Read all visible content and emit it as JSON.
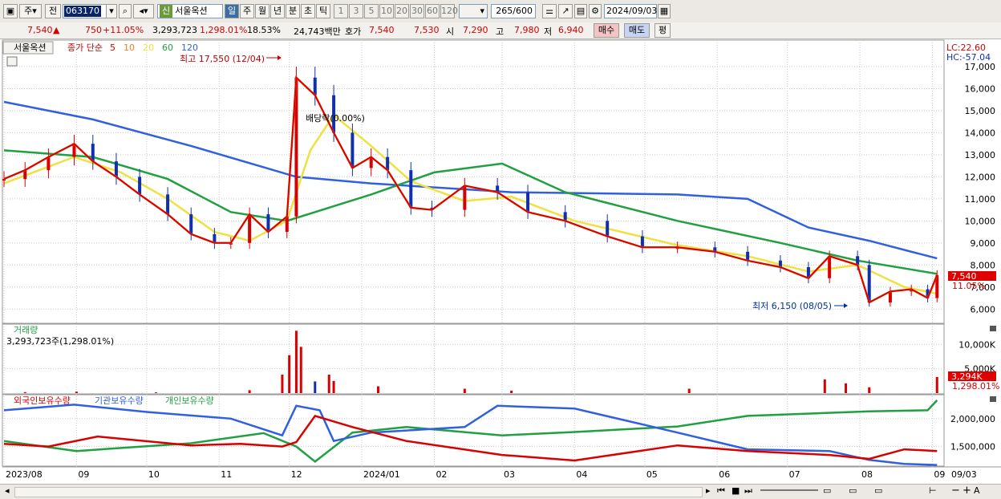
{
  "toolbar": {
    "market": "주",
    "prev_label": "전",
    "code": "063170",
    "stock_badge": "신",
    "stock_name": "서울옥션",
    "periods": [
      "일",
      "주",
      "월",
      "년",
      "분",
      "초",
      "틱"
    ],
    "intervals": [
      "1",
      "3",
      "5",
      "10",
      "20",
      "30",
      "60",
      "120"
    ],
    "count": "265",
    "count_total": "/600",
    "date": "2024/09/03"
  },
  "quote": {
    "price": "7,540",
    "change": "750",
    "change_pct": "+11.05%",
    "volume": "3,293,723",
    "volume_pct": "1,298.01%",
    "turnover_pct": "18.53%",
    "amount": "24,743백만",
    "ask_label": "호가",
    "ask": "7,540",
    "bid": "7,530",
    "open_label": "시",
    "open": "7,290",
    "high_label": "고",
    "high": "7,980",
    "low_label": "저",
    "low": "6,940",
    "buy": "매수",
    "sell": "매도",
    "eval": "평"
  },
  "chart_data": {
    "type": "line",
    "title": "서울옥션",
    "price_panel": {
      "legend_label": "종가 단순",
      "ma_periods": [
        5,
        10,
        20,
        60,
        120
      ],
      "ma_colors": [
        "#d80000",
        "#f08020",
        "#f0e040",
        "#20a040",
        "#3060e0"
      ],
      "ylim": [
        5500,
        17800
      ],
      "y_ticks": [
        6000,
        7000,
        8000,
        9000,
        10000,
        11000,
        12000,
        13000,
        14000,
        15000,
        16000,
        17000
      ],
      "y_tick_labels": [
        "6,000",
        "7,000",
        "8,000",
        "9,000",
        "10,000",
        "11,000",
        "12,000",
        "13,000",
        "14,000",
        "15,000",
        "16,000",
        "17,000"
      ],
      "lc": "LC:22.60",
      "hc": "HC:-57.04",
      "high_note": "최고 17,550 (12/04)",
      "low_note": "최저 6,150 (08/05)",
      "dividend_note": "배당락(0.00%)",
      "last_price": "7,540",
      "last_pct": "11.05%",
      "close_series": [
        {
          "d": "2023-08-01",
          "v": 11900
        },
        {
          "d": "2023-08-10",
          "v": 12300
        },
        {
          "d": "2023-08-20",
          "v": 12900
        },
        {
          "d": "2023-08-31",
          "v": 13500
        },
        {
          "d": "2023-09-08",
          "v": 12700
        },
        {
          "d": "2023-09-18",
          "v": 12000
        },
        {
          "d": "2023-09-28",
          "v": 11200
        },
        {
          "d": "2023-10-10",
          "v": 10300
        },
        {
          "d": "2023-10-20",
          "v": 9400
        },
        {
          "d": "2023-10-30",
          "v": 9000
        },
        {
          "d": "2023-11-06",
          "v": 9000
        },
        {
          "d": "2023-11-14",
          "v": 10300
        },
        {
          "d": "2023-11-22",
          "v": 9500
        },
        {
          "d": "2023-11-30",
          "v": 10200
        },
        {
          "d": "2023-12-04",
          "v": 16500
        },
        {
          "d": "2023-12-12",
          "v": 15700
        },
        {
          "d": "2023-12-20",
          "v": 14000
        },
        {
          "d": "2023-12-28",
          "v": 12400
        },
        {
          "d": "2024-01-05",
          "v": 12900
        },
        {
          "d": "2024-01-12",
          "v": 12300
        },
        {
          "d": "2024-01-22",
          "v": 10600
        },
        {
          "d": "2024-01-31",
          "v": 10500
        },
        {
          "d": "2024-02-14",
          "v": 11600
        },
        {
          "d": "2024-02-28",
          "v": 11300
        },
        {
          "d": "2024-03-12",
          "v": 10400
        },
        {
          "d": "2024-03-28",
          "v": 10000
        },
        {
          "d": "2024-04-15",
          "v": 9300
        },
        {
          "d": "2024-04-30",
          "v": 8800
        },
        {
          "d": "2024-05-15",
          "v": 8800
        },
        {
          "d": "2024-05-31",
          "v": 8600
        },
        {
          "d": "2024-06-14",
          "v": 8200
        },
        {
          "d": "2024-06-28",
          "v": 7900
        },
        {
          "d": "2024-07-10",
          "v": 7400
        },
        {
          "d": "2024-07-19",
          "v": 8400
        },
        {
          "d": "2024-07-31",
          "v": 8000
        },
        {
          "d": "2024-08-05",
          "v": 6300
        },
        {
          "d": "2024-08-14",
          "v": 6800
        },
        {
          "d": "2024-08-23",
          "v": 6900
        },
        {
          "d": "2024-08-30",
          "v": 6500
        },
        {
          "d": "2024-09-03",
          "v": 7540
        }
      ],
      "ma20": [
        {
          "d": "2023-08-01",
          "v": 11700
        },
        {
          "d": "2023-08-31",
          "v": 12900
        },
        {
          "d": "2023-09-20",
          "v": 12200
        },
        {
          "d": "2023-10-10",
          "v": 11000
        },
        {
          "d": "2023-10-30",
          "v": 9500
        },
        {
          "d": "2023-11-14",
          "v": 9100
        },
        {
          "d": "2023-11-30",
          "v": 10000
        },
        {
          "d": "2023-12-10",
          "v": 13200
        },
        {
          "d": "2023-12-20",
          "v": 14800
        },
        {
          "d": "2024-01-05",
          "v": 13400
        },
        {
          "d": "2024-01-22",
          "v": 11800
        },
        {
          "d": "2024-02-14",
          "v": 10900
        },
        {
          "d": "2024-03-05",
          "v": 11100
        },
        {
          "d": "2024-04-01",
          "v": 10000
        },
        {
          "d": "2024-05-15",
          "v": 8900
        },
        {
          "d": "2024-06-14",
          "v": 8400
        },
        {
          "d": "2024-07-10",
          "v": 7700
        },
        {
          "d": "2024-07-31",
          "v": 8000
        },
        {
          "d": "2024-08-20",
          "v": 7000
        },
        {
          "d": "2024-09-03",
          "v": 6700
        }
      ],
      "ma60": [
        {
          "d": "2023-08-01",
          "v": 13200
        },
        {
          "d": "2023-09-08",
          "v": 12900
        },
        {
          "d": "2023-10-10",
          "v": 11900
        },
        {
          "d": "2023-11-06",
          "v": 10400
        },
        {
          "d": "2023-11-30",
          "v": 10000
        },
        {
          "d": "2024-01-05",
          "v": 11200
        },
        {
          "d": "2024-02-01",
          "v": 12200
        },
        {
          "d": "2024-03-01",
          "v": 12600
        },
        {
          "d": "2024-03-28",
          "v": 11300
        },
        {
          "d": "2024-05-15",
          "v": 10000
        },
        {
          "d": "2024-06-28",
          "v": 9000
        },
        {
          "d": "2024-07-31",
          "v": 8200
        },
        {
          "d": "2024-09-03",
          "v": 7600
        }
      ],
      "ma120": [
        {
          "d": "2023-08-01",
          "v": 15400
        },
        {
          "d": "2023-09-08",
          "v": 14600
        },
        {
          "d": "2023-10-20",
          "v": 13400
        },
        {
          "d": "2023-12-04",
          "v": 12000
        },
        {
          "d": "2024-01-05",
          "v": 11700
        },
        {
          "d": "2024-03-05",
          "v": 11300
        },
        {
          "d": "2024-05-15",
          "v": 11200
        },
        {
          "d": "2024-06-14",
          "v": 11000
        },
        {
          "d": "2024-07-10",
          "v": 9700
        },
        {
          "d": "2024-08-05",
          "v": 9100
        },
        {
          "d": "2024-09-03",
          "v": 8300
        }
      ]
    },
    "volume_panel": {
      "label": "거래량",
      "value_text": "3,293,723주(1,298.01%)",
      "ylim": [
        0,
        14000000
      ],
      "y_tick_labels": [
        "5,000K",
        "10,000K"
      ],
      "y_ticks": [
        5000000,
        10000000
      ],
      "last_label": "3,294K",
      "last_pct": "1,298.01%",
      "bars": [
        {
          "d": "2023-08-10",
          "v": 200000
        },
        {
          "d": "2023-09-01",
          "v": 300000
        },
        {
          "d": "2023-10-05",
          "v": 150000
        },
        {
          "d": "2023-11-14",
          "v": 600000
        },
        {
          "d": "2023-11-28",
          "v": 3800000
        },
        {
          "d": "2023-12-01",
          "v": 7800000
        },
        {
          "d": "2023-12-04",
          "v": 12800000
        },
        {
          "d": "2023-12-06",
          "v": 9500000
        },
        {
          "d": "2023-12-12",
          "v": 2400000
        },
        {
          "d": "2023-12-18",
          "v": 3800000
        },
        {
          "d": "2023-12-20",
          "v": 2500000
        },
        {
          "d": "2024-01-08",
          "v": 1400000
        },
        {
          "d": "2024-02-14",
          "v": 900000
        },
        {
          "d": "2024-03-05",
          "v": 500000
        },
        {
          "d": "2024-05-20",
          "v": 900000
        },
        {
          "d": "2024-07-17",
          "v": 2800000
        },
        {
          "d": "2024-07-26",
          "v": 2000000
        },
        {
          "d": "2024-08-05",
          "v": 1200000
        },
        {
          "d": "2024-09-03",
          "v": 3293723
        }
      ]
    },
    "holdings_panel": {
      "legend": [
        "외국인보유수량",
        "기관보유수량",
        "개인보유수량"
      ],
      "colors": [
        "#d80000",
        "#3060e0",
        "#20a040"
      ],
      "ylim": [
        1150000,
        2400000
      ],
      "y_ticks": [
        1500000,
        2000000
      ],
      "y_tick_labels": [
        "1,500,000",
        "2,000,000"
      ],
      "foreign": [
        {
          "d": "2023-08-01",
          "v": 1550000
        },
        {
          "d": "2023-08-20",
          "v": 1500000
        },
        {
          "d": "2023-09-10",
          "v": 1680000
        },
        {
          "d": "2023-10-20",
          "v": 1520000
        },
        {
          "d": "2023-11-10",
          "v": 1550000
        },
        {
          "d": "2023-11-28",
          "v": 1500000
        },
        {
          "d": "2023-12-04",
          "v": 1580000
        },
        {
          "d": "2023-12-12",
          "v": 2050000
        },
        {
          "d": "2023-12-28",
          "v": 1850000
        },
        {
          "d": "2024-01-20",
          "v": 1600000
        },
        {
          "d": "2024-03-01",
          "v": 1350000
        },
        {
          "d": "2024-04-01",
          "v": 1250000
        },
        {
          "d": "2024-05-15",
          "v": 1520000
        },
        {
          "d": "2024-06-14",
          "v": 1420000
        },
        {
          "d": "2024-07-19",
          "v": 1350000
        },
        {
          "d": "2024-08-05",
          "v": 1280000
        },
        {
          "d": "2024-08-20",
          "v": 1450000
        },
        {
          "d": "2024-09-03",
          "v": 1420000
        }
      ],
      "institution": [
        {
          "d": "2023-08-01",
          "v": 2150000
        },
        {
          "d": "2023-08-31",
          "v": 2250000
        },
        {
          "d": "2023-10-01",
          "v": 2120000
        },
        {
          "d": "2023-11-06",
          "v": 2000000
        },
        {
          "d": "2023-11-28",
          "v": 1700000
        },
        {
          "d": "2023-12-04",
          "v": 2230000
        },
        {
          "d": "2023-12-14",
          "v": 2150000
        },
        {
          "d": "2023-12-20",
          "v": 1600000
        },
        {
          "d": "2024-01-05",
          "v": 1750000
        },
        {
          "d": "2024-02-14",
          "v": 1850000
        },
        {
          "d": "2024-02-28",
          "v": 2230000
        },
        {
          "d": "2024-04-01",
          "v": 2180000
        },
        {
          "d": "2024-05-15",
          "v": 1750000
        },
        {
          "d": "2024-06-14",
          "v": 1450000
        },
        {
          "d": "2024-07-19",
          "v": 1420000
        },
        {
          "d": "2024-08-05",
          "v": 1260000
        },
        {
          "d": "2024-08-20",
          "v": 1190000
        },
        {
          "d": "2024-09-03",
          "v": 1170000
        }
      ],
      "individual": [
        {
          "d": "2023-08-01",
          "v": 1600000
        },
        {
          "d": "2023-09-01",
          "v": 1420000
        },
        {
          "d": "2023-10-20",
          "v": 1560000
        },
        {
          "d": "2023-11-20",
          "v": 1740000
        },
        {
          "d": "2023-12-04",
          "v": 1500000
        },
        {
          "d": "2023-12-12",
          "v": 1230000
        },
        {
          "d": "2023-12-28",
          "v": 1750000
        },
        {
          "d": "2024-01-20",
          "v": 1850000
        },
        {
          "d": "2024-03-01",
          "v": 1700000
        },
        {
          "d": "2024-04-01",
          "v": 1760000
        },
        {
          "d": "2024-05-15",
          "v": 1860000
        },
        {
          "d": "2024-06-14",
          "v": 2050000
        },
        {
          "d": "2024-08-05",
          "v": 2130000
        },
        {
          "d": "2024-08-30",
          "v": 2150000
        },
        {
          "d": "2024-09-03",
          "v": 2330000
        }
      ]
    },
    "x_labels": [
      {
        "d": "2023-08-01",
        "t": "2023/08"
      },
      {
        "d": "2023-09-01",
        "t": "09"
      },
      {
        "d": "2023-10-01",
        "t": "10"
      },
      {
        "d": "2023-11-01",
        "t": "11"
      },
      {
        "d": "2023-12-01",
        "t": "12"
      },
      {
        "d": "2024-01-01",
        "t": "2024/01"
      },
      {
        "d": "2024-02-01",
        "t": "02"
      },
      {
        "d": "2024-03-01",
        "t": "03"
      },
      {
        "d": "2024-04-01",
        "t": "04"
      },
      {
        "d": "2024-05-01",
        "t": "05"
      },
      {
        "d": "2024-06-01",
        "t": "06"
      },
      {
        "d": "2024-07-01",
        "t": "07"
      },
      {
        "d": "2024-08-01",
        "t": "08"
      },
      {
        "d": "2024-09-01",
        "t": "09"
      }
    ],
    "right_x_label": "09/03",
    "x_range": [
      "2023-08-01",
      "2024-09-06"
    ]
  },
  "colors": {
    "up": "#d80000",
    "down": "#1030b0",
    "accent": "#0a246a"
  }
}
